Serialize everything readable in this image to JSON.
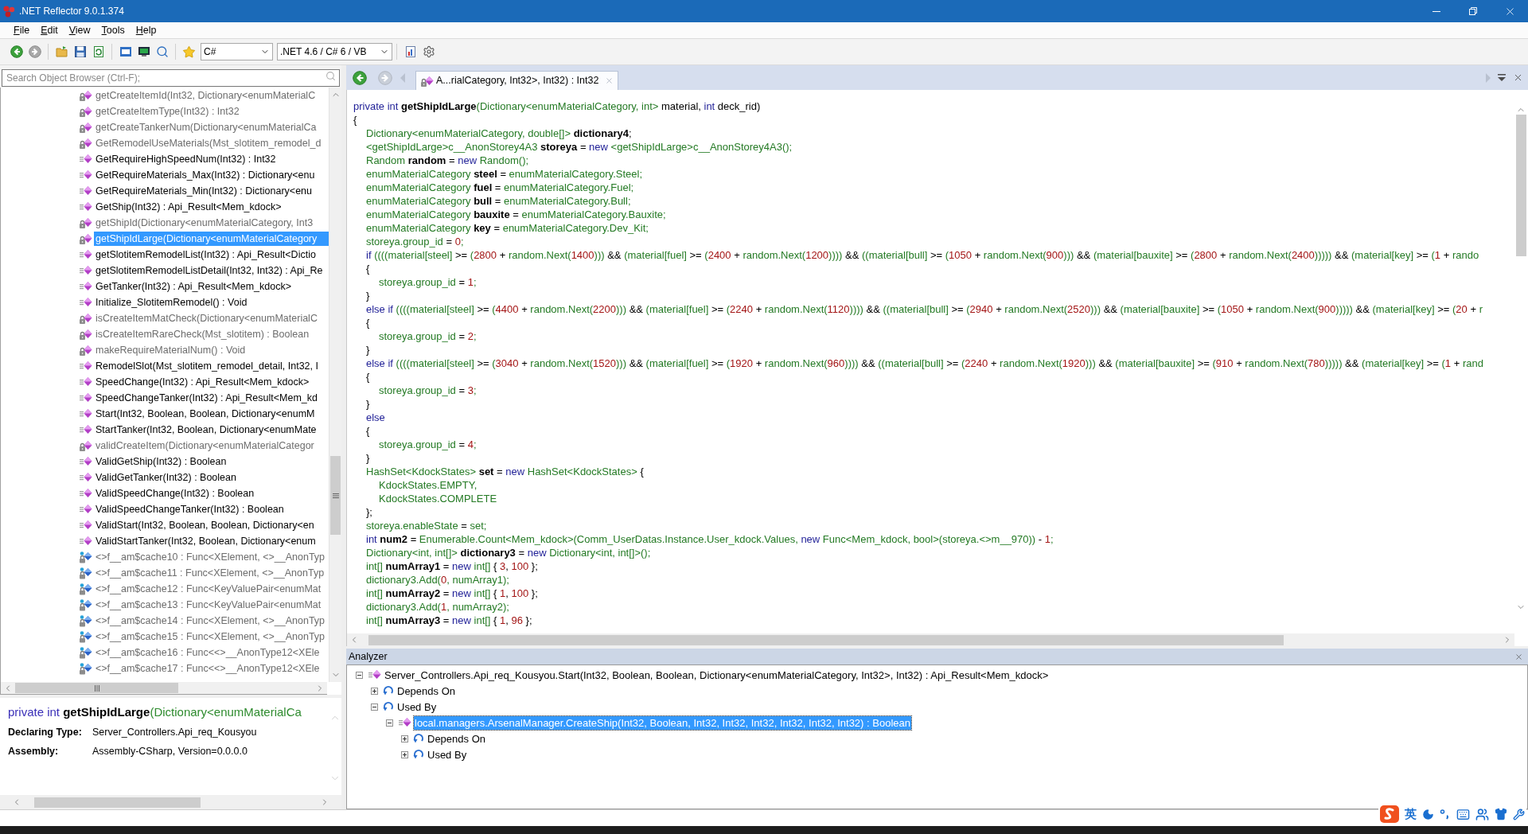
{
  "window": {
    "title": ".NET Reflector 9.0.1.374"
  },
  "menu": [
    {
      "label": "File"
    },
    {
      "label": "Edit"
    },
    {
      "label": "View"
    },
    {
      "label": "Tools"
    },
    {
      "label": "Help"
    }
  ],
  "toolbar": {
    "language": "C#",
    "framework": ".NET 4.6 / C# 6 / VB"
  },
  "search": {
    "placeholder": "Search Object Browser (Ctrl-F);"
  },
  "members": [
    {
      "kind": "method",
      "private": true,
      "selected": false,
      "label": "getCreateItemId(Int32, Dictionary<enumMaterialC"
    },
    {
      "kind": "method",
      "private": true,
      "selected": false,
      "label": "getCreateItemType(Int32) : Int32"
    },
    {
      "kind": "method",
      "private": true,
      "selected": false,
      "label": "getCreateTankerNum(Dictionary<enumMaterialCa"
    },
    {
      "kind": "method",
      "private": true,
      "selected": false,
      "label": "GetRemodelUseMaterials(Mst_slotitem_remodel_d"
    },
    {
      "kind": "method",
      "private": false,
      "selected": false,
      "label": "GetRequireHighSpeedNum(Int32) : Int32"
    },
    {
      "kind": "method",
      "private": false,
      "selected": false,
      "label": "GetRequireMaterials_Max(Int32) : Dictionary<enu"
    },
    {
      "kind": "method",
      "private": false,
      "selected": false,
      "label": "GetRequireMaterials_Min(Int32) : Dictionary<enu"
    },
    {
      "kind": "method",
      "private": false,
      "selected": false,
      "label": "GetShip(Int32) : Api_Result<Mem_kdock>"
    },
    {
      "kind": "method",
      "private": true,
      "selected": false,
      "label": "getShipId(Dictionary<enumMaterialCategory, Int3"
    },
    {
      "kind": "method",
      "private": true,
      "selected": true,
      "label": "getShipIdLarge(Dictionary<enumMaterialCategory"
    },
    {
      "kind": "method",
      "private": false,
      "selected": false,
      "label": "getSlotitemRemodelList(Int32) : Api_Result<Dictio"
    },
    {
      "kind": "method",
      "private": false,
      "selected": false,
      "label": "getSlotitemRemodelListDetail(Int32, Int32) : Api_Re"
    },
    {
      "kind": "method",
      "private": false,
      "selected": false,
      "label": "GetTanker(Int32) : Api_Result<Mem_kdock>"
    },
    {
      "kind": "method",
      "private": false,
      "selected": false,
      "label": "Initialize_SlotitemRemodel() : Void"
    },
    {
      "kind": "method",
      "private": true,
      "selected": false,
      "label": "isCreateItemMatCheck(Dictionary<enumMaterialC"
    },
    {
      "kind": "method",
      "private": true,
      "selected": false,
      "label": "isCreateItemRareCheck(Mst_slotitem) : Boolean"
    },
    {
      "kind": "method",
      "private": true,
      "selected": false,
      "label": "makeRequireMaterialNum() : Void"
    },
    {
      "kind": "method",
      "private": false,
      "selected": false,
      "label": "RemodelSlot(Mst_slotitem_remodel_detail, Int32, I"
    },
    {
      "kind": "method",
      "private": false,
      "selected": false,
      "label": "SpeedChange(Int32) : Api_Result<Mem_kdock>"
    },
    {
      "kind": "method",
      "private": false,
      "selected": false,
      "label": "SpeedChangeTanker(Int32) : Api_Result<Mem_kd"
    },
    {
      "kind": "method",
      "private": false,
      "selected": false,
      "label": "Start(Int32, Boolean, Boolean, Dictionary<enumM"
    },
    {
      "kind": "method",
      "private": false,
      "selected": false,
      "label": "StartTanker(Int32, Boolean, Dictionary<enumMate"
    },
    {
      "kind": "method",
      "private": true,
      "selected": false,
      "label": "validCreateItem(Dictionary<enumMaterialCategor"
    },
    {
      "kind": "method",
      "private": false,
      "selected": false,
      "label": "ValidGetShip(Int32) : Boolean"
    },
    {
      "kind": "method",
      "private": false,
      "selected": false,
      "label": "ValidGetTanker(Int32) : Boolean"
    },
    {
      "kind": "method",
      "private": false,
      "selected": false,
      "label": "ValidSpeedChange(Int32) : Boolean"
    },
    {
      "kind": "method",
      "private": false,
      "selected": false,
      "label": "ValidSpeedChangeTanker(Int32) : Boolean"
    },
    {
      "kind": "method",
      "private": false,
      "selected": false,
      "label": "ValidStart(Int32, Boolean, Boolean, Dictionary<en"
    },
    {
      "kind": "method",
      "private": false,
      "selected": false,
      "label": "ValidStartTanker(Int32, Boolean, Dictionary<enum"
    },
    {
      "kind": "field",
      "private": true,
      "selected": false,
      "label": "<>f__am$cache10 : Func<XElement, <>__AnonTyp"
    },
    {
      "kind": "field",
      "private": true,
      "selected": false,
      "label": "<>f__am$cache11 : Func<XElement, <>__AnonTyp"
    },
    {
      "kind": "field",
      "private": true,
      "selected": false,
      "label": "<>f__am$cache12 : Func<KeyValuePair<enumMat"
    },
    {
      "kind": "field",
      "private": true,
      "selected": false,
      "label": "<>f__am$cache13 : Func<KeyValuePair<enumMat"
    },
    {
      "kind": "field",
      "private": true,
      "selected": false,
      "label": "<>f__am$cache14 : Func<XElement, <>__AnonTyp"
    },
    {
      "kind": "field",
      "private": true,
      "selected": false,
      "label": "<>f__am$cache15 : Func<XElement, <>__AnonTyp"
    },
    {
      "kind": "field",
      "private": true,
      "selected": false,
      "label": "<>f__am$cache16 : Func<<>__AnonType12<XEle"
    },
    {
      "kind": "field",
      "private": true,
      "selected": false,
      "label": "<>f__am$cache17 : Func<<>__AnonType12<XEle"
    }
  ],
  "details": {
    "signature": [
      {
        "kind": "keyword",
        "text": "private int "
      },
      {
        "kind": "declaration",
        "text": "getShipIdLarge"
      },
      {
        "kind": "reference",
        "text": "(Dictionary<enumMaterialCa"
      }
    ],
    "fields": [
      {
        "label": "Declaring Type:",
        "value": "Server_Controllers.Api_req_Kousyou"
      },
      {
        "label": "Assembly:",
        "value": "Assembly-CSharp, Version=0.0.0.0"
      }
    ]
  },
  "document_tab": {
    "title": "A...rialCategory, Int32>, Int32) : Int32",
    "selected": true
  },
  "code": [
    {
      "tokens": [
        {
          "kind": "keyword",
          "text": "private int "
        },
        {
          "kind": "declaration",
          "text": "getShipIdLarge"
        },
        {
          "kind": "reference",
          "text": "(Dictionary<enumMaterialCategory, int>"
        },
        {
          "kind": "plain",
          "text": " material, "
        },
        {
          "kind": "keyword",
          "text": "int"
        },
        {
          "kind": "plain",
          "text": " deck_rid)"
        }
      ]
    },
    {
      "tokens": [
        {
          "kind": "plain",
          "text": "{"
        }
      ]
    },
    {
      "tokens": [
        {
          "kind": "reference",
          "text": "\tDictionary<enumMaterialCategory, double[]> "
        },
        {
          "kind": "declaration",
          "text": "dictionary4"
        },
        {
          "kind": "plain",
          "text": ";"
        }
      ]
    },
    {
      "tokens": [
        {
          "kind": "reference",
          "text": "\t<getShipIdLarge>c__AnonStorey4A3 "
        },
        {
          "kind": "declaration",
          "text": "storeya"
        },
        {
          "kind": "plain",
          "text": " = "
        },
        {
          "kind": "keyword",
          "text": "new"
        },
        {
          "kind": "reference",
          "text": " <getShipIdLarge>c__AnonStorey4A3();"
        }
      ]
    },
    {
      "tokens": [
        {
          "kind": "reference",
          "text": "\tRandom "
        },
        {
          "kind": "declaration",
          "text": "random"
        },
        {
          "kind": "plain",
          "text": " = "
        },
        {
          "kind": "keyword",
          "text": "new"
        },
        {
          "kind": "reference",
          "text": " Random();"
        }
      ]
    },
    {
      "tokens": [
        {
          "kind": "reference",
          "text": "\tenumMaterialCategory "
        },
        {
          "kind": "declaration",
          "text": "steel"
        },
        {
          "kind": "plain",
          "text": " = "
        },
        {
          "kind": "reference",
          "text": "enumMaterialCategory.Steel;"
        }
      ]
    },
    {
      "tokens": [
        {
          "kind": "reference",
          "text": "\tenumMaterialCategory "
        },
        {
          "kind": "declaration",
          "text": "fuel"
        },
        {
          "kind": "plain",
          "text": " = "
        },
        {
          "kind": "reference",
          "text": "enumMaterialCategory.Fuel;"
        }
      ]
    },
    {
      "tokens": [
        {
          "kind": "reference",
          "text": "\tenumMaterialCategory "
        },
        {
          "kind": "declaration",
          "text": "bull"
        },
        {
          "kind": "plain",
          "text": " = "
        },
        {
          "kind": "reference",
          "text": "enumMaterialCategory.Bull;"
        }
      ]
    },
    {
      "tokens": [
        {
          "kind": "reference",
          "text": "\tenumMaterialCategory "
        },
        {
          "kind": "declaration",
          "text": "bauxite"
        },
        {
          "kind": "plain",
          "text": " = "
        },
        {
          "kind": "reference",
          "text": "enumMaterialCategory.Bauxite;"
        }
      ]
    },
    {
      "tokens": [
        {
          "kind": "reference",
          "text": "\tenumMaterialCategory "
        },
        {
          "kind": "declaration",
          "text": "key"
        },
        {
          "kind": "plain",
          "text": " = "
        },
        {
          "kind": "reference",
          "text": "enumMaterialCategory.Dev_Kit;"
        }
      ]
    },
    {
      "tokens": [
        {
          "kind": "reference",
          "text": "\tstoreya.group_id"
        },
        {
          "kind": "plain",
          "text": " = "
        },
        {
          "kind": "number",
          "text": "0"
        },
        {
          "kind": "reference",
          "text": ";"
        }
      ]
    },
    {
      "tokens": [
        {
          "kind": "keyword",
          "text": "\tif "
        },
        {
          "kind": "reference",
          "text": "((((material[steel]"
        },
        {
          "kind": "plain",
          "text": " >= "
        },
        {
          "kind": "reference",
          "text": "("
        },
        {
          "kind": "number",
          "text": "2800"
        },
        {
          "kind": "plain",
          "text": " + "
        },
        {
          "kind": "reference",
          "text": "random.Next("
        },
        {
          "kind": "number",
          "text": "1400"
        },
        {
          "kind": "reference",
          "text": ")))"
        },
        {
          "kind": "plain",
          "text": " && "
        },
        {
          "kind": "reference",
          "text": "(material[fuel]"
        },
        {
          "kind": "plain",
          "text": " >= "
        },
        {
          "kind": "reference",
          "text": "("
        },
        {
          "kind": "number",
          "text": "2400"
        },
        {
          "kind": "plain",
          "text": " + "
        },
        {
          "kind": "reference",
          "text": "random.Next("
        },
        {
          "kind": "number",
          "text": "1200"
        },
        {
          "kind": "reference",
          "text": "))))"
        },
        {
          "kind": "plain",
          "text": " && "
        },
        {
          "kind": "reference",
          "text": "((material[bull]"
        },
        {
          "kind": "plain",
          "text": " >= "
        },
        {
          "kind": "reference",
          "text": "("
        },
        {
          "kind": "number",
          "text": "1050"
        },
        {
          "kind": "plain",
          "text": " + "
        },
        {
          "kind": "reference",
          "text": "random.Next("
        },
        {
          "kind": "number",
          "text": "900"
        },
        {
          "kind": "reference",
          "text": ")))"
        },
        {
          "kind": "plain",
          "text": " && "
        },
        {
          "kind": "reference",
          "text": "(material[bauxite]"
        },
        {
          "kind": "plain",
          "text": " >= "
        },
        {
          "kind": "reference",
          "text": "("
        },
        {
          "kind": "number",
          "text": "2800"
        },
        {
          "kind": "plain",
          "text": " + "
        },
        {
          "kind": "reference",
          "text": "random.Next("
        },
        {
          "kind": "number",
          "text": "2400"
        },
        {
          "kind": "reference",
          "text": ")))))"
        },
        {
          "kind": "plain",
          "text": " && "
        },
        {
          "kind": "reference",
          "text": "(material[key]"
        },
        {
          "kind": "plain",
          "text": " >= "
        },
        {
          "kind": "reference",
          "text": "("
        },
        {
          "kind": "number",
          "text": "1"
        },
        {
          "kind": "plain",
          "text": " + "
        },
        {
          "kind": "reference",
          "text": "rando"
        }
      ]
    },
    {
      "tokens": [
        {
          "kind": "plain",
          "text": "\t{"
        }
      ]
    },
    {
      "tokens": [
        {
          "kind": "reference",
          "text": "\t\tstoreya.group_id"
        },
        {
          "kind": "plain",
          "text": " = "
        },
        {
          "kind": "number",
          "text": "1"
        },
        {
          "kind": "reference",
          "text": ";"
        }
      ]
    },
    {
      "tokens": [
        {
          "kind": "plain",
          "text": "\t}"
        }
      ]
    },
    {
      "tokens": [
        {
          "kind": "keyword",
          "text": "\telse if "
        },
        {
          "kind": "reference",
          "text": "((((material[steel]"
        },
        {
          "kind": "plain",
          "text": " >= "
        },
        {
          "kind": "reference",
          "text": "("
        },
        {
          "kind": "number",
          "text": "4400"
        },
        {
          "kind": "plain",
          "text": " + "
        },
        {
          "kind": "reference",
          "text": "random.Next("
        },
        {
          "kind": "number",
          "text": "2200"
        },
        {
          "kind": "reference",
          "text": ")))"
        },
        {
          "kind": "plain",
          "text": " && "
        },
        {
          "kind": "reference",
          "text": "(material[fuel]"
        },
        {
          "kind": "plain",
          "text": " >= "
        },
        {
          "kind": "reference",
          "text": "("
        },
        {
          "kind": "number",
          "text": "2240"
        },
        {
          "kind": "plain",
          "text": " + "
        },
        {
          "kind": "reference",
          "text": "random.Next("
        },
        {
          "kind": "number",
          "text": "1120"
        },
        {
          "kind": "reference",
          "text": "))))"
        },
        {
          "kind": "plain",
          "text": " && "
        },
        {
          "kind": "reference",
          "text": "((material[bull]"
        },
        {
          "kind": "plain",
          "text": " >= "
        },
        {
          "kind": "reference",
          "text": "("
        },
        {
          "kind": "number",
          "text": "2940"
        },
        {
          "kind": "plain",
          "text": " + "
        },
        {
          "kind": "reference",
          "text": "random.Next("
        },
        {
          "kind": "number",
          "text": "2520"
        },
        {
          "kind": "reference",
          "text": ")))"
        },
        {
          "kind": "plain",
          "text": " && "
        },
        {
          "kind": "reference",
          "text": "(material[bauxite]"
        },
        {
          "kind": "plain",
          "text": " >= "
        },
        {
          "kind": "reference",
          "text": "("
        },
        {
          "kind": "number",
          "text": "1050"
        },
        {
          "kind": "plain",
          "text": " + "
        },
        {
          "kind": "reference",
          "text": "random.Next("
        },
        {
          "kind": "number",
          "text": "900"
        },
        {
          "kind": "reference",
          "text": ")))))"
        },
        {
          "kind": "plain",
          "text": " && "
        },
        {
          "kind": "reference",
          "text": "(material[key]"
        },
        {
          "kind": "plain",
          "text": " >= "
        },
        {
          "kind": "reference",
          "text": "("
        },
        {
          "kind": "number",
          "text": "20"
        },
        {
          "kind": "plain",
          "text": " + "
        },
        {
          "kind": "reference",
          "text": "r"
        }
      ]
    },
    {
      "tokens": [
        {
          "kind": "plain",
          "text": "\t{"
        }
      ]
    },
    {
      "tokens": [
        {
          "kind": "reference",
          "text": "\t\tstoreya.group_id"
        },
        {
          "kind": "plain",
          "text": " = "
        },
        {
          "kind": "number",
          "text": "2"
        },
        {
          "kind": "reference",
          "text": ";"
        }
      ]
    },
    {
      "tokens": [
        {
          "kind": "plain",
          "text": "\t}"
        }
      ]
    },
    {
      "tokens": [
        {
          "kind": "keyword",
          "text": "\telse if "
        },
        {
          "kind": "reference",
          "text": "((((material[steel]"
        },
        {
          "kind": "plain",
          "text": " >= "
        },
        {
          "kind": "reference",
          "text": "("
        },
        {
          "kind": "number",
          "text": "3040"
        },
        {
          "kind": "plain",
          "text": " + "
        },
        {
          "kind": "reference",
          "text": "random.Next("
        },
        {
          "kind": "number",
          "text": "1520"
        },
        {
          "kind": "reference",
          "text": ")))"
        },
        {
          "kind": "plain",
          "text": " && "
        },
        {
          "kind": "reference",
          "text": "(material[fuel]"
        },
        {
          "kind": "plain",
          "text": " >= "
        },
        {
          "kind": "reference",
          "text": "("
        },
        {
          "kind": "number",
          "text": "1920"
        },
        {
          "kind": "plain",
          "text": " + "
        },
        {
          "kind": "reference",
          "text": "random.Next("
        },
        {
          "kind": "number",
          "text": "960"
        },
        {
          "kind": "reference",
          "text": "))))"
        },
        {
          "kind": "plain",
          "text": " && "
        },
        {
          "kind": "reference",
          "text": "((material[bull]"
        },
        {
          "kind": "plain",
          "text": " >= "
        },
        {
          "kind": "reference",
          "text": "("
        },
        {
          "kind": "number",
          "text": "2240"
        },
        {
          "kind": "plain",
          "text": " + "
        },
        {
          "kind": "reference",
          "text": "random.Next("
        },
        {
          "kind": "number",
          "text": "1920"
        },
        {
          "kind": "reference",
          "text": ")))"
        },
        {
          "kind": "plain",
          "text": " && "
        },
        {
          "kind": "reference",
          "text": "(material[bauxite]"
        },
        {
          "kind": "plain",
          "text": " >= "
        },
        {
          "kind": "reference",
          "text": "("
        },
        {
          "kind": "number",
          "text": "910"
        },
        {
          "kind": "plain",
          "text": " + "
        },
        {
          "kind": "reference",
          "text": "random.Next("
        },
        {
          "kind": "number",
          "text": "780"
        },
        {
          "kind": "reference",
          "text": ")))))"
        },
        {
          "kind": "plain",
          "text": " && "
        },
        {
          "kind": "reference",
          "text": "(material[key]"
        },
        {
          "kind": "plain",
          "text": " >= "
        },
        {
          "kind": "reference",
          "text": "("
        },
        {
          "kind": "number",
          "text": "1"
        },
        {
          "kind": "plain",
          "text": " + "
        },
        {
          "kind": "reference",
          "text": "rand"
        }
      ]
    },
    {
      "tokens": [
        {
          "kind": "plain",
          "text": "\t{"
        }
      ]
    },
    {
      "tokens": [
        {
          "kind": "reference",
          "text": "\t\tstoreya.group_id"
        },
        {
          "kind": "plain",
          "text": " = "
        },
        {
          "kind": "number",
          "text": "3"
        },
        {
          "kind": "reference",
          "text": ";"
        }
      ]
    },
    {
      "tokens": [
        {
          "kind": "plain",
          "text": "\t}"
        }
      ]
    },
    {
      "tokens": [
        {
          "kind": "keyword",
          "text": "\telse"
        }
      ]
    },
    {
      "tokens": [
        {
          "kind": "plain",
          "text": "\t{"
        }
      ]
    },
    {
      "tokens": [
        {
          "kind": "reference",
          "text": "\t\tstoreya.group_id"
        },
        {
          "kind": "plain",
          "text": " = "
        },
        {
          "kind": "number",
          "text": "4"
        },
        {
          "kind": "reference",
          "text": ";"
        }
      ]
    },
    {
      "tokens": [
        {
          "kind": "plain",
          "text": "\t}"
        }
      ]
    },
    {
      "tokens": [
        {
          "kind": "reference",
          "text": "\tHashSet<KdockStates> "
        },
        {
          "kind": "declaration",
          "text": "set"
        },
        {
          "kind": "plain",
          "text": " = "
        },
        {
          "kind": "keyword",
          "text": "new"
        },
        {
          "kind": "reference",
          "text": " HashSet<KdockStates>"
        },
        {
          "kind": "plain",
          "text": " {"
        }
      ]
    },
    {
      "tokens": [
        {
          "kind": "reference",
          "text": "\t\tKdockStates.EMPTY,"
        }
      ]
    },
    {
      "tokens": [
        {
          "kind": "reference",
          "text": "\t\tKdockStates.COMPLETE"
        }
      ]
    },
    {
      "tokens": [
        {
          "kind": "plain",
          "text": "\t};"
        }
      ]
    },
    {
      "tokens": [
        {
          "kind": "reference",
          "text": "\tstoreya.enableState"
        },
        {
          "kind": "plain",
          "text": " = "
        },
        {
          "kind": "reference",
          "text": "set;"
        }
      ]
    },
    {
      "tokens": [
        {
          "kind": "keyword",
          "text": "\tint "
        },
        {
          "kind": "declaration",
          "text": "num2"
        },
        {
          "kind": "plain",
          "text": " = "
        },
        {
          "kind": "reference",
          "text": "Enumerable.Count<Mem_kdock>(Comm_UserDatas.Instance.User_kdock.Values, "
        },
        {
          "kind": "keyword",
          "text": "new"
        },
        {
          "kind": "reference",
          "text": " Func<Mem_kdock, bool>(storeya.<>m__970))"
        },
        {
          "kind": "plain",
          "text": " - "
        },
        {
          "kind": "number",
          "text": "1"
        },
        {
          "kind": "reference",
          "text": ";"
        }
      ]
    },
    {
      "tokens": [
        {
          "kind": "reference",
          "text": "\tDictionary<int, int[]> "
        },
        {
          "kind": "declaration",
          "text": "dictionary3"
        },
        {
          "kind": "plain",
          "text": " = "
        },
        {
          "kind": "keyword",
          "text": "new"
        },
        {
          "kind": "reference",
          "text": " Dictionary<int, int[]>();"
        }
      ]
    },
    {
      "tokens": [
        {
          "kind": "reference",
          "text": "\tint[] "
        },
        {
          "kind": "declaration",
          "text": "numArray1"
        },
        {
          "kind": "plain",
          "text": " = "
        },
        {
          "kind": "keyword",
          "text": "new"
        },
        {
          "kind": "reference",
          "text": " int[]"
        },
        {
          "kind": "plain",
          "text": " { "
        },
        {
          "kind": "number",
          "text": "3"
        },
        {
          "kind": "plain",
          "text": ", "
        },
        {
          "kind": "number",
          "text": "100"
        },
        {
          "kind": "plain",
          "text": " };"
        }
      ]
    },
    {
      "tokens": [
        {
          "kind": "reference",
          "text": "\tdictionary3.Add("
        },
        {
          "kind": "number",
          "text": "0"
        },
        {
          "kind": "reference",
          "text": ", numArray1);"
        }
      ]
    },
    {
      "tokens": [
        {
          "kind": "reference",
          "text": "\tint[] "
        },
        {
          "kind": "declaration",
          "text": "numArray2"
        },
        {
          "kind": "plain",
          "text": " = "
        },
        {
          "kind": "keyword",
          "text": "new"
        },
        {
          "kind": "reference",
          "text": " int[]"
        },
        {
          "kind": "plain",
          "text": " { "
        },
        {
          "kind": "number",
          "text": "1"
        },
        {
          "kind": "plain",
          "text": ", "
        },
        {
          "kind": "number",
          "text": "100"
        },
        {
          "kind": "plain",
          "text": " };"
        }
      ]
    },
    {
      "tokens": [
        {
          "kind": "reference",
          "text": "\tdictionary3.Add("
        },
        {
          "kind": "number",
          "text": "1"
        },
        {
          "kind": "reference",
          "text": ", numArray2);"
        }
      ]
    },
    {
      "tokens": [
        {
          "kind": "reference",
          "text": "\tint[] "
        },
        {
          "kind": "declaration",
          "text": "numArray3"
        },
        {
          "kind": "plain",
          "text": " = "
        },
        {
          "kind": "keyword",
          "text": "new"
        },
        {
          "kind": "reference",
          "text": " int[]"
        },
        {
          "kind": "plain",
          "text": " { "
        },
        {
          "kind": "number",
          "text": "1"
        },
        {
          "kind": "plain",
          "text": ", "
        },
        {
          "kind": "number",
          "text": "96"
        },
        {
          "kind": "plain",
          "text": " };"
        }
      ]
    }
  ],
  "analyzer": {
    "title": "Analyzer",
    "nodes": [
      {
        "kind": "method",
        "label": "Server_Controllers.Api_req_Kousyou.Start(Int32, Boolean, Boolean, Dictionary<enumMaterialCategory, Int32>, Int32) : Api_Result<Mem_kdock>",
        "expanded": true,
        "selected": false,
        "children": [
          {
            "kind": "group",
            "label": "Depends On",
            "expanded": false,
            "selected": false
          },
          {
            "kind": "group",
            "label": "Used By",
            "expanded": true,
            "selected": false,
            "children": [
              {
                "kind": "method",
                "label": "local.managers.ArsenalManager.CreateShip(Int32, Boolean, Int32, Int32, Int32, Int32, Int32, Int32) : Boolean",
                "expanded": true,
                "selected": true,
                "children": [
                  {
                    "kind": "group",
                    "label": "Depends On",
                    "expanded": false,
                    "selected": false
                  },
                  {
                    "kind": "group",
                    "label": "Used By",
                    "expanded": false,
                    "selected": false
                  }
                ]
              }
            ]
          }
        ]
      }
    ]
  },
  "ime": {
    "mode": "英"
  }
}
